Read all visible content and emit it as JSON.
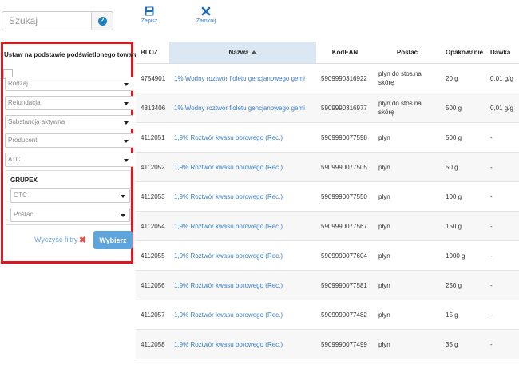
{
  "search": {
    "placeholder": "Szukaj"
  },
  "toolbar": {
    "save_label": "Zapisz",
    "close_label": "Zamknij"
  },
  "filters": {
    "highlight_label": "Ustaw na podstawie podświetlonego towaru",
    "selects": [
      {
        "placeholder": "Rodzaj"
      },
      {
        "placeholder": "Refundacja"
      },
      {
        "placeholder": "Substancja aktywna"
      },
      {
        "placeholder": "Producent"
      },
      {
        "placeholder": "ATC"
      }
    ],
    "grupex": {
      "title": "GRUPEX",
      "selects": [
        {
          "placeholder": "OTC"
        },
        {
          "placeholder": "Postać"
        }
      ]
    },
    "clear_label": "Wyczyść filtry",
    "choose_label": "Wybierz",
    "border_color": "#d71920"
  },
  "table": {
    "columns": [
      "BLOZ",
      "Nazwa",
      "KodEAN",
      "Postać",
      "Opakowanie",
      "Dawka"
    ],
    "sorted_column": "Nazwa",
    "sort_direction": "asc",
    "rows": [
      {
        "bloz": "4754901",
        "nazwa": "1% Wodny roztwór fioletu gencjanowego gemi",
        "ean": "5909990316922",
        "postac": "płyn do stos.na skórę",
        "opakowanie": "20 g",
        "dawka": "0,01 g/g"
      },
      {
        "bloz": "4813406",
        "nazwa": "1% Wodny roztwór fioletu gencjanowego gemi",
        "ean": "5909990316977",
        "postac": "płyn do stos.na skórę",
        "opakowanie": "500 g",
        "dawka": "0,01 g/g"
      },
      {
        "bloz": "4112051",
        "nazwa": "1,9% Roztwór kwasu borowego (Rec.)",
        "ean": "5909990077598",
        "postac": "płyn",
        "opakowanie": "500 g",
        "dawka": "-"
      },
      {
        "bloz": "4112052",
        "nazwa": "1,9% Roztwór kwasu borowego (Rec.)",
        "ean": "5909990077505",
        "postac": "płyn",
        "opakowanie": "50 g",
        "dawka": "-"
      },
      {
        "bloz": "4112053",
        "nazwa": "1,9% Roztwór kwasu borowego (Rec.)",
        "ean": "5909990077550",
        "postac": "płyn",
        "opakowanie": "100 g",
        "dawka": "-"
      },
      {
        "bloz": "4112054",
        "nazwa": "1,9% Roztwór kwasu borowego (Rec.)",
        "ean": "5909990077567",
        "postac": "płyn",
        "opakowanie": "150 g",
        "dawka": "-"
      },
      {
        "bloz": "4112055",
        "nazwa": "1,9% Roztwór kwasu borowego (Rec.)",
        "ean": "5909990077604",
        "postac": "płyn",
        "opakowanie": "1000 g",
        "dawka": "-"
      },
      {
        "bloz": "4112056",
        "nazwa": "1,9% Roztwór kwasu borowego (Rec.)",
        "ean": "5909990077581",
        "postac": "płyn",
        "opakowanie": "250 g",
        "dawka": "-"
      },
      {
        "bloz": "4112057",
        "nazwa": "1,9% Roztwór kwasu borowego (Rec.)",
        "ean": "5909990077482",
        "postac": "płyn",
        "opakowanie": "15 g",
        "dawka": "-"
      },
      {
        "bloz": "4112058",
        "nazwa": "1,9% Roztwór kwasu borowego (Rec.)",
        "ean": "5909990077499",
        "postac": "płyn",
        "opakowanie": "35 g",
        "dawka": "-"
      }
    ]
  }
}
